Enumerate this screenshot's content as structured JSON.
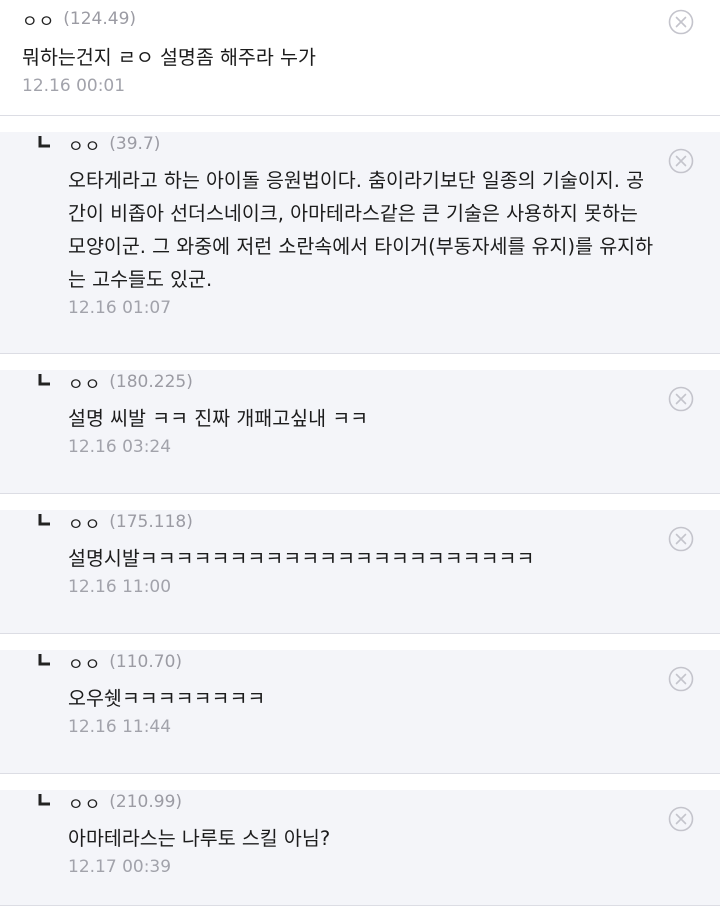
{
  "comments": [
    {
      "nick": "ㅇㅇ",
      "ip": "(124.49)",
      "lines": [
        "뭐하는건지 ㄹㅇ 설명좀 해주라 누가"
      ],
      "time": "12.16 00:01"
    },
    {
      "nick": "ㅇㅇ",
      "ip": "(39.7)",
      "lines": [
        "오타게라고 하는 아이돌 응원법이다. 춤이라기보단 일종의 기술이지. 공",
        "간이 비좁아 선더스네이크, 아마테라스같은 큰 기술은 사용하지 못하는",
        "모양이군. 그 와중에 저런 소란속에서 타이거(부동자세를 유지)를 유지하",
        "는 고수들도 있군."
      ],
      "time": "12.16 01:07"
    },
    {
      "nick": "ㅇㅇ",
      "ip": "(180.225)",
      "lines": [
        "설명 씨발 ㅋㅋ 진짜 개패고싶내 ㅋㅋ"
      ],
      "time": "12.16 03:24"
    },
    {
      "nick": "ㅇㅇ",
      "ip": "(175.118)",
      "lines": [
        "설명시발ㅋㅋㅋㅋㅋㅋㅋㅋㅋㅋㅋㅋㅋㅋㅋㅋㅋㅋㅋㅋㅋㅋ"
      ],
      "time": "12.16 11:00"
    },
    {
      "nick": "ㅇㅇ",
      "ip": "(110.70)",
      "lines": [
        "오우쉣ㅋㅋㅋㅋㅋㅋㅋㅋ"
      ],
      "time": "12.16 11:44"
    },
    {
      "nick": "ㅇㅇ",
      "ip": "(210.99)",
      "lines": [
        "아마테라스는 나루토 스킬 아님?"
      ],
      "time": "12.17 00:39"
    }
  ],
  "icons": {
    "reply": "reply-arrow-icon",
    "delete": "close-circle-icon"
  },
  "colors": {
    "reply_bg": "#f4f5f9",
    "muted": "#9b9ba3",
    "divider": "#dcdde4"
  }
}
